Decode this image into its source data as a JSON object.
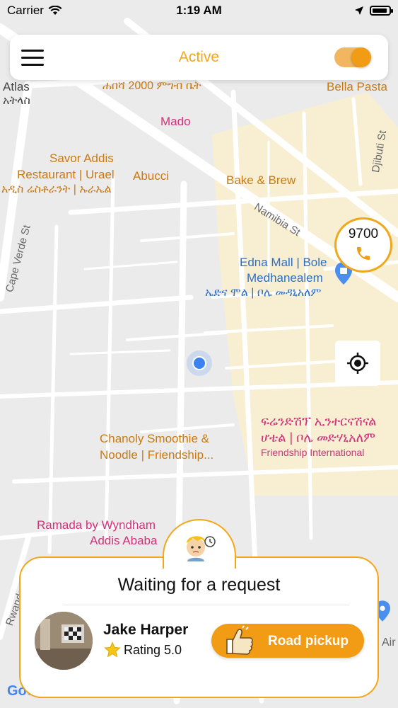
{
  "status_bar": {
    "carrier": "Carrier",
    "time": "1:19 AM",
    "battery_level": 0.9
  },
  "header": {
    "title": "Active",
    "toggle_on": true,
    "accent_color": "#f2a71b"
  },
  "map": {
    "labels": {
      "atlas": "Atlas",
      "atlas_amh": "አትላስ",
      "hibsh": "ሐበሻ 2000 ምግብ ቤት",
      "bella_pasta": "Bella Pasta",
      "mado": "Mado",
      "savor_1": "Savor Addis",
      "savor_2": "Restaurant | Urael",
      "savor_amh": "አዲስ ሬስቶራንት | ኡራኤል",
      "abucci": "Abucci",
      "bake_brew": "Bake & Brew",
      "namibia_st": "Namibia St",
      "djibuti_st": "Djibuti St",
      "cape_verde_st": "Cape Verde St",
      "edna_1": "Edna Mall | Bole",
      "edna_2": "Medhanealem",
      "edna_amh": "ኤድና ሞል | ቦሌ መዳኒአለም",
      "friendship_amh_1": "ፍሬንድሽፕ ኢንተርናሽናል",
      "friendship_amh_2": "ሆቴል | ቦሌ መድሃኒአለም",
      "friendship_en": "Friendship International",
      "chanoly_1": "Chanoly Smoothie &",
      "chanoly_2": "Noodle | Friendship...",
      "ramada_1": "Ramada by Wyndham",
      "ramada_2": "Addis Ababa",
      "rwanda_st": "Rwanda St",
      "air_partial": "Air",
      "google": "Google"
    },
    "call_bubble": {
      "count": "9700",
      "icon": "phone-icon"
    },
    "locate_icon": "crosshair-icon"
  },
  "request_panel": {
    "title": "Waiting for a request",
    "driver_name": "Jake Harper",
    "rating_label": "Rating 5.0",
    "pickup_button": "Road pickup",
    "colors": {
      "accent": "#f29b14",
      "star": "#f5c518"
    }
  }
}
